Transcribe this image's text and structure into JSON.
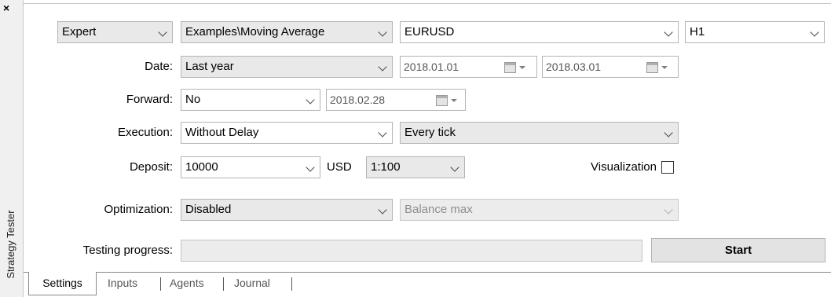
{
  "panel": {
    "close_symbol": "×",
    "title": "Strategy Tester"
  },
  "row1": {
    "program_type": "Expert",
    "program_name": "Examples\\Moving Average",
    "symbol": "EURUSD",
    "timeframe": "H1"
  },
  "date": {
    "label": "Date:",
    "mode": "Last year",
    "from": "2018.01.01",
    "to": "2018.03.01"
  },
  "forward": {
    "label": "Forward:",
    "mode": "No",
    "date": "2018.02.28"
  },
  "execution": {
    "label": "Execution:",
    "mode": "Without Delay",
    "model": "Every tick"
  },
  "deposit": {
    "label": "Deposit:",
    "amount": "10000",
    "currency": "USD",
    "leverage": "1:100",
    "visualization_label": "Visualization",
    "visualization_checked": false
  },
  "optimization": {
    "label": "Optimization:",
    "mode": "Disabled",
    "criterion": "Balance max"
  },
  "progress": {
    "label": "Testing progress:",
    "value": 0
  },
  "start_button": "Start",
  "tabs": [
    {
      "label": "Settings",
      "active": true
    },
    {
      "label": "Inputs",
      "active": false
    },
    {
      "label": "Agents",
      "active": false
    },
    {
      "label": "Journal",
      "active": false
    }
  ]
}
